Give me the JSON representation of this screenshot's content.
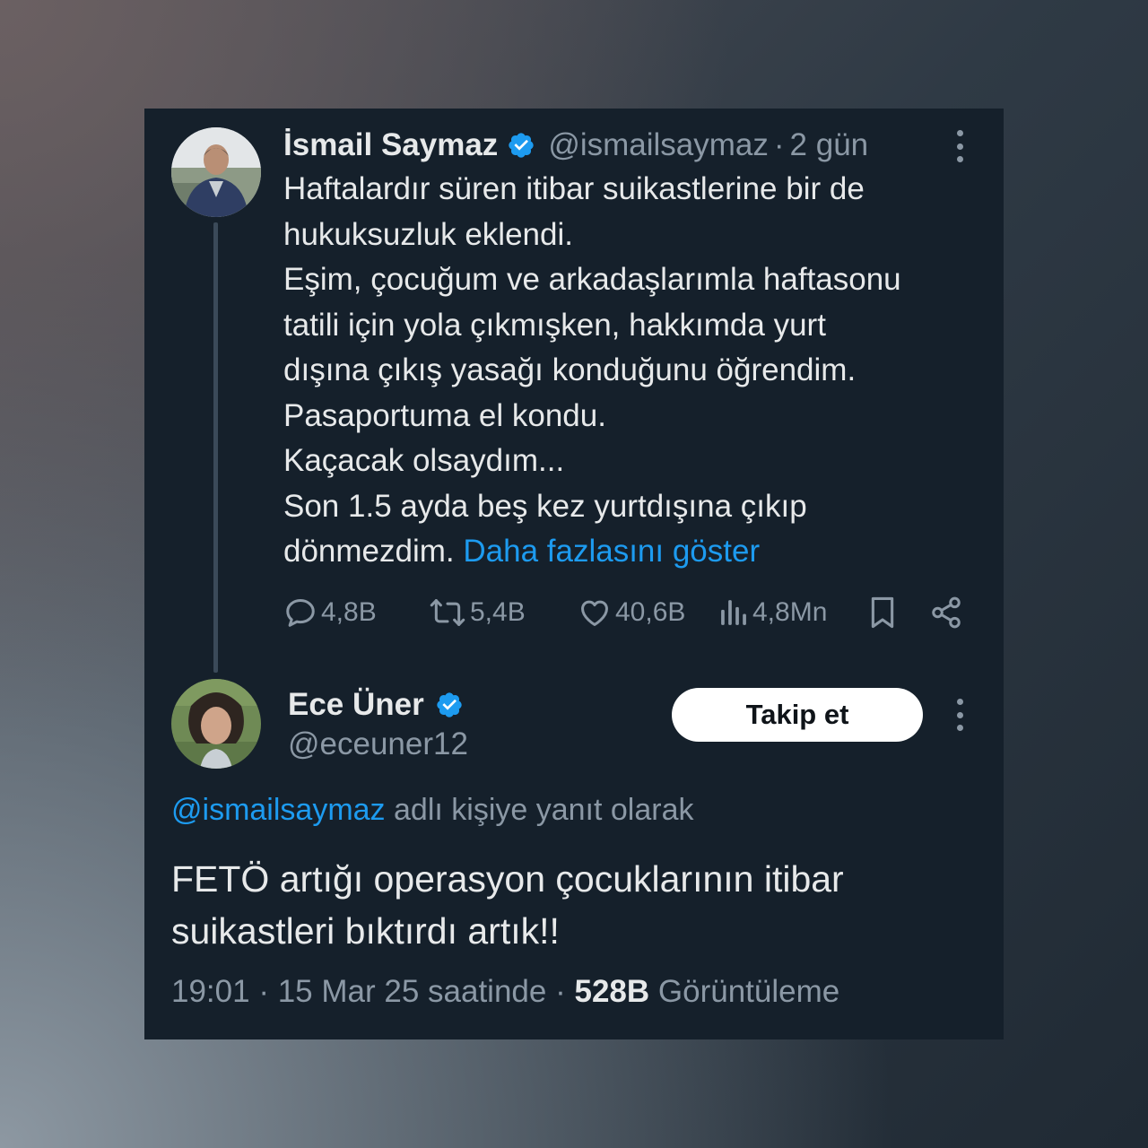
{
  "colors": {
    "card_bg": "#15202b",
    "text": "#e7e9ea",
    "muted": "#8b98a5",
    "link": "#1d9bf0",
    "verified": "#1d9bf0",
    "thread_line": "#3b4a59",
    "follow_bg": "#ffffff"
  },
  "original_tweet": {
    "author_name": "İsmail Saymaz",
    "handle": "@ismailsaymaz",
    "separator": "·",
    "time_ago": "2 gün",
    "lines": [
      "Haftalardır süren itibar suikastlerine bir de",
      "hukuksuzluk eklendi.",
      "Eşim, çocuğum ve arkadaşlarımla haftasonu",
      "tatili için yola çıkmışken, hakkımda yurt",
      "dışına çıkış yasağı konduğunu öğrendim.",
      "Pasaportuma el kondu.",
      "Kaçacak olsaydım...",
      "Son 1.5 ayda beş kez yurtdışına çıkıp",
      "dönmezdim."
    ],
    "show_more": "Daha fazlasını göster",
    "actions": {
      "reply_count": "4,8B",
      "retweet_count": "5,4B",
      "like_count": "40,6B",
      "view_count": "4,8Mn"
    },
    "icons": [
      "reply-icon",
      "retweet-icon",
      "like-icon",
      "views-icon",
      "bookmark-icon",
      "share-icon"
    ]
  },
  "reply_tweet": {
    "author_name": "Ece Üner",
    "handle": "@eceuner12",
    "follow_label": "Takip et",
    "replying_to_handle": "@ismailsaymaz",
    "replying_to_text": "adlı kişiye yanıt olarak",
    "lines": [
      "FETÖ artığı operasyon çocuklarının itibar",
      "suikastleri bıktırdı artık!!"
    ],
    "time": "19:01",
    "date": "15 Mar 25 saatinde",
    "separator": "·",
    "views_count": "528B",
    "views_label": "Görüntüleme"
  }
}
